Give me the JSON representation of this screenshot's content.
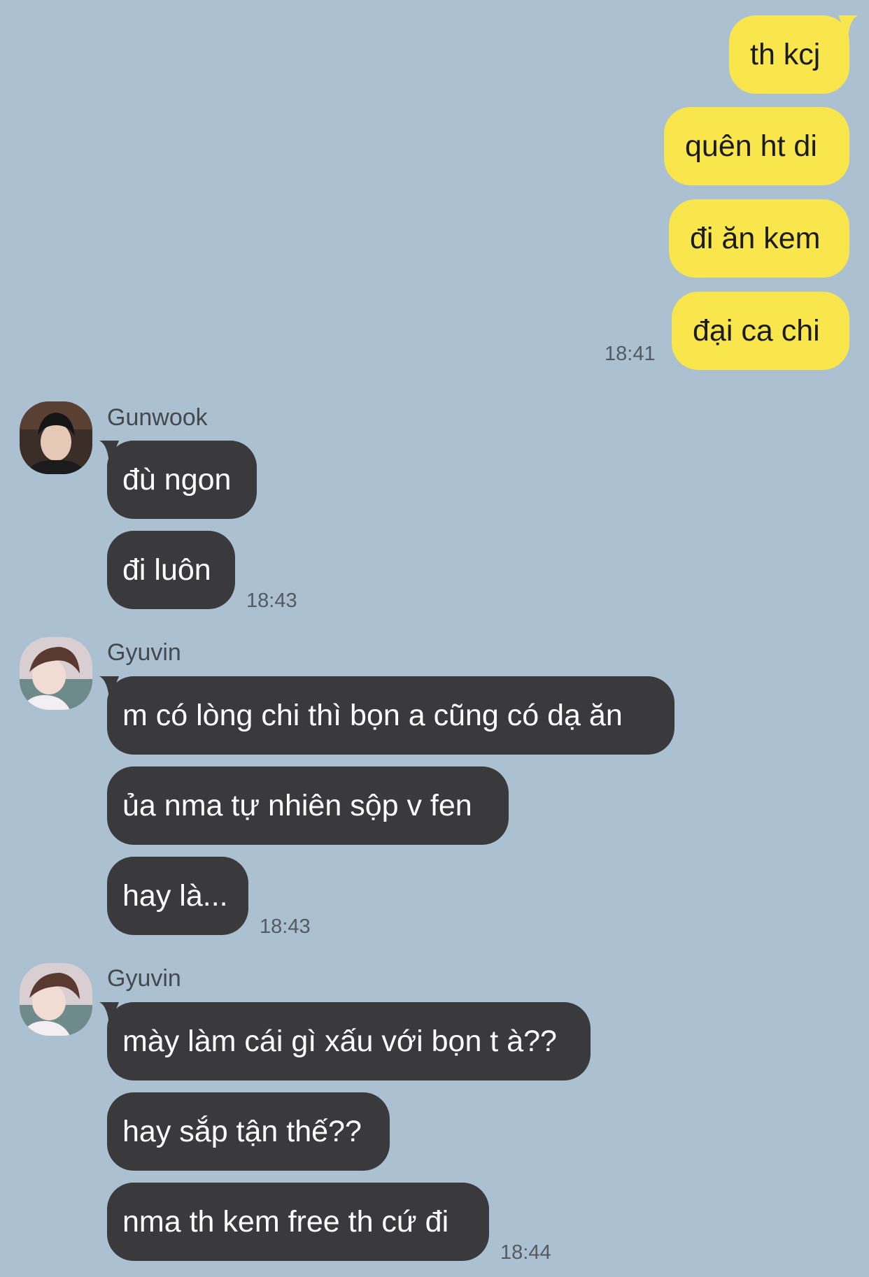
{
  "colors": {
    "background": "#abc1d1",
    "outgoing_bubble": "#f9e54c",
    "incoming_bubble": "#3a3a3c"
  },
  "outgoing_group": {
    "messages": [
      "th kcj",
      "quên ht di",
      "đi ăn kem",
      "đại ca chi"
    ],
    "time": "18:41"
  },
  "incoming_groups": [
    {
      "sender": "Gunwook",
      "avatar": "avatar-photo-gunwook",
      "messages": [
        "đù ngon",
        "đi luôn"
      ],
      "time": "18:43"
    },
    {
      "sender": "Gyuvin",
      "avatar": "avatar-photo-gyuvin",
      "messages": [
        "m có lòng chi thì bọn a cũng có dạ ăn",
        "ủa nma tự nhiên sộp v fen",
        "hay là..."
      ],
      "time": "18:43"
    },
    {
      "sender": "Gyuvin",
      "avatar": "avatar-photo-gyuvin",
      "messages": [
        "mày làm cái gì xấu với bọn t à??",
        "hay sắp tận thế??",
        "nma th kem free th cứ đi"
      ],
      "time": "18:44"
    }
  ]
}
